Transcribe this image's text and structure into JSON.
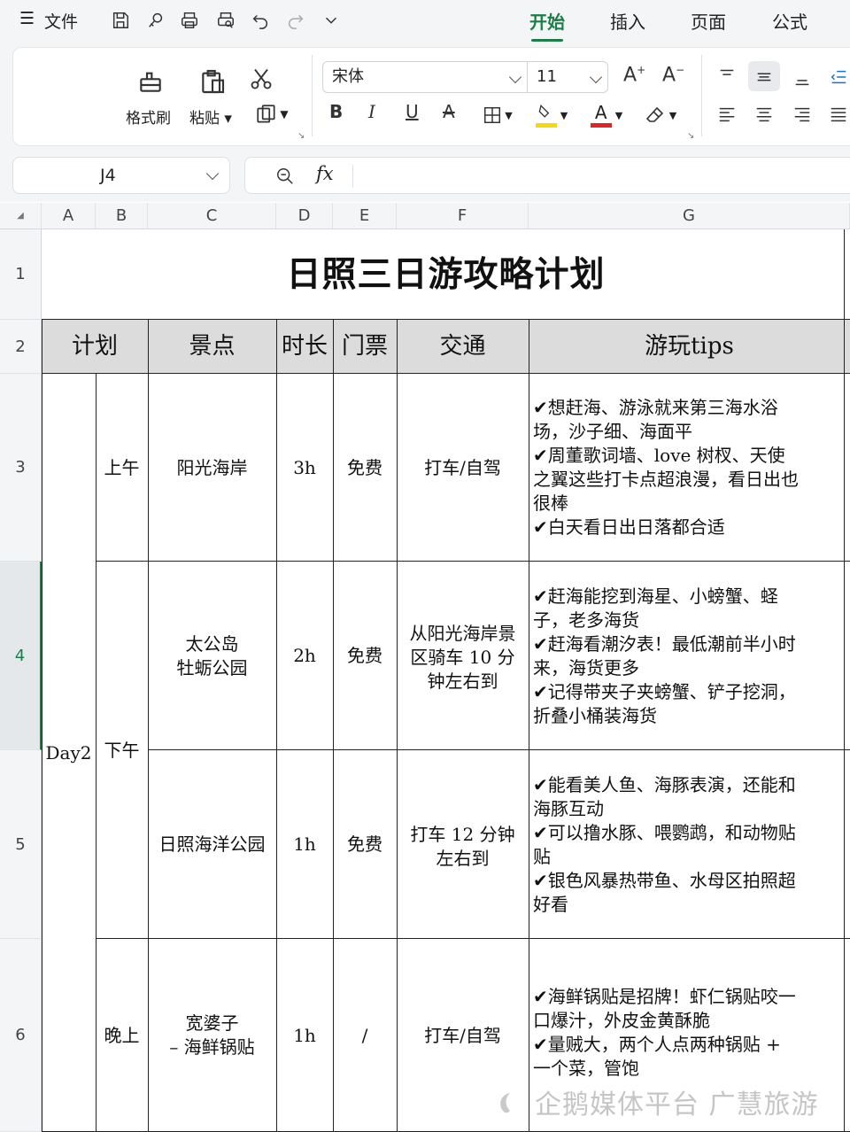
{
  "menubar": {
    "file_label": "文件",
    "tabs": [
      {
        "label": "开始",
        "active": true
      },
      {
        "label": "插入",
        "active": false
      },
      {
        "label": "页面",
        "active": false
      },
      {
        "label": "公式",
        "active": false
      }
    ]
  },
  "ribbon": {
    "format_painter_label": "格式刷",
    "paste_label": "粘贴",
    "font_name": "宋体",
    "font_size": "11",
    "underline_color": "#f5d90a",
    "font_color": "#e02424"
  },
  "formula_bar": {
    "cell_ref": "J4",
    "fx_label": "fx",
    "content": ""
  },
  "grid": {
    "columns": [
      "A",
      "B",
      "C",
      "D",
      "E",
      "F",
      "G"
    ],
    "rows": [
      "1",
      "2",
      "3",
      "4",
      "5",
      "6"
    ],
    "active_row": "4"
  },
  "sheet": {
    "title": "日照三日游攻略计划",
    "headers": {
      "plan": "计划",
      "spot": "景点",
      "duration": "时长",
      "ticket": "门票",
      "transport": "交通",
      "tips": "游玩tips"
    },
    "day": "Day2",
    "periods": {
      "morning": "上午",
      "afternoon": "下午",
      "evening": "晚上"
    },
    "rows": [
      {
        "spot": [
          "阳光海岸"
        ],
        "duration": "3h",
        "ticket": "免费",
        "transport": [
          "打车/自驾"
        ],
        "tips": [
          "✔想赶海、游泳就来第三海水浴",
          "场，沙子细、海面平",
          "✔周董歌词墙、love 树杈、天使",
          "之翼这些打卡点超浪漫，看日出也",
          "很棒",
          "✔白天看日出日落都合适"
        ]
      },
      {
        "spot": [
          "太公岛",
          "牡蛎公园"
        ],
        "duration": "2h",
        "ticket": "免费",
        "transport": [
          "从阳光海岸景",
          "区骑车 10 分",
          "钟左右到"
        ],
        "tips": [
          "✔赶海能挖到海星、小螃蟹、蛏",
          "子，老多海货",
          "✔赶海看潮汐表！最低潮前半小时",
          "来，海货更多",
          "✔记得带夹子夹螃蟹、铲子挖洞，",
          "折叠小桶装海货"
        ]
      },
      {
        "spot": [
          "日照海洋公园"
        ],
        "duration": "1h",
        "ticket": "免费",
        "transport": [
          "打车 12 分钟",
          "左右到"
        ],
        "tips": [
          "✔能看美人鱼、海豚表演，还能和",
          "海豚互动",
          "✔可以撸水豚、喂鹦鹉，和动物贴",
          "贴",
          "✔银色风暴热带鱼、水母区拍照超",
          "好看"
        ]
      },
      {
        "spot": [
          "宽婆子",
          "– 海鲜锅贴"
        ],
        "duration": "1h",
        "ticket": "/",
        "transport": [
          "打车/自驾"
        ],
        "tips": [
          "✔海鲜锅贴是招牌！虾仁锅贴咬一",
          "口爆汁，外皮金黄酥脆",
          "✔量贼大，两个人点两种锅贴 +",
          "一个菜，管饱"
        ]
      }
    ]
  },
  "watermark": "企鹅媒体平台 广慧旅游"
}
